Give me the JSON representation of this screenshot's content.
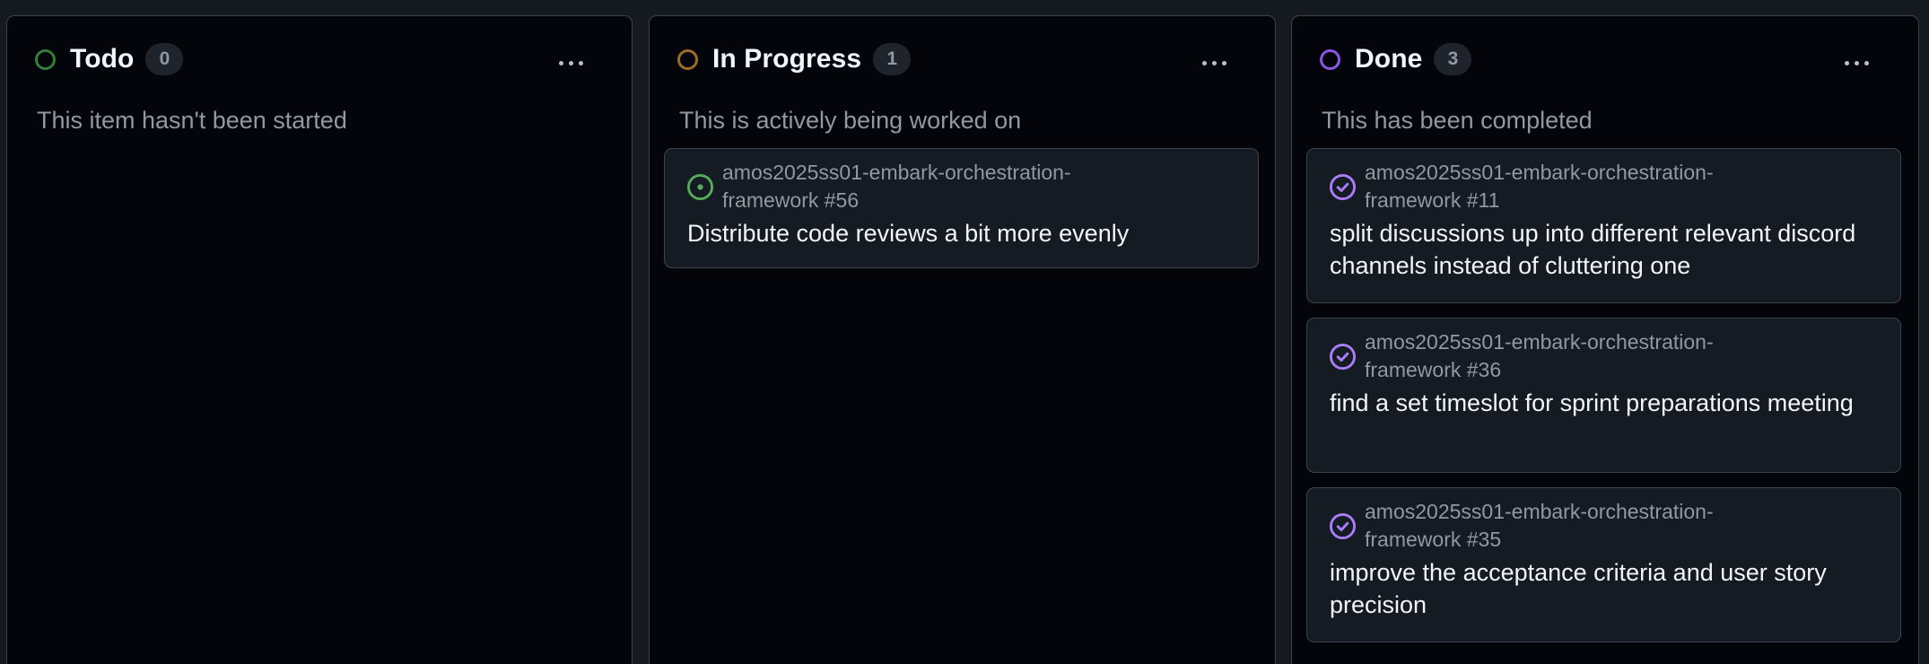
{
  "columns": [
    {
      "title": "Todo",
      "count": "0",
      "description": "This item hasn't been started",
      "status_color": "#347d39",
      "cards": []
    },
    {
      "title": "In Progress",
      "count": "1",
      "description": "This is actively being worked on",
      "status_color": "#9e6a27",
      "cards": [
        {
          "icon": "issue-opened-icon",
          "icon_color": "#57ab5a",
          "repo_line1": "amos2025ss01-embark-orchestration-",
          "repo_line2": "framework #56",
          "title": "Distribute code reviews a bit more evenly"
        }
      ]
    },
    {
      "title": "Done",
      "count": "3",
      "description": "This has been completed",
      "status_color": "#8957e5",
      "cards": [
        {
          "icon": "issue-closed-icon",
          "icon_color": "#ab7df8",
          "repo_line1": "amos2025ss01-embark-orchestration-",
          "repo_line2": "framework #11",
          "title": "split discussions up into different relevant discord channels instead of cluttering one"
        },
        {
          "icon": "issue-closed-icon",
          "icon_color": "#ab7df8",
          "repo_line1": "amos2025ss01-embark-orchestration-",
          "repo_line2": "framework #36",
          "title": "find a set timeslot for sprint preparations meeting"
        },
        {
          "icon": "issue-closed-icon",
          "icon_color": "#ab7df8",
          "repo_line1": "amos2025ss01-embark-orchestration-",
          "repo_line2": "framework #35",
          "title": "improve the acceptance criteria and user story precision"
        }
      ]
    }
  ]
}
